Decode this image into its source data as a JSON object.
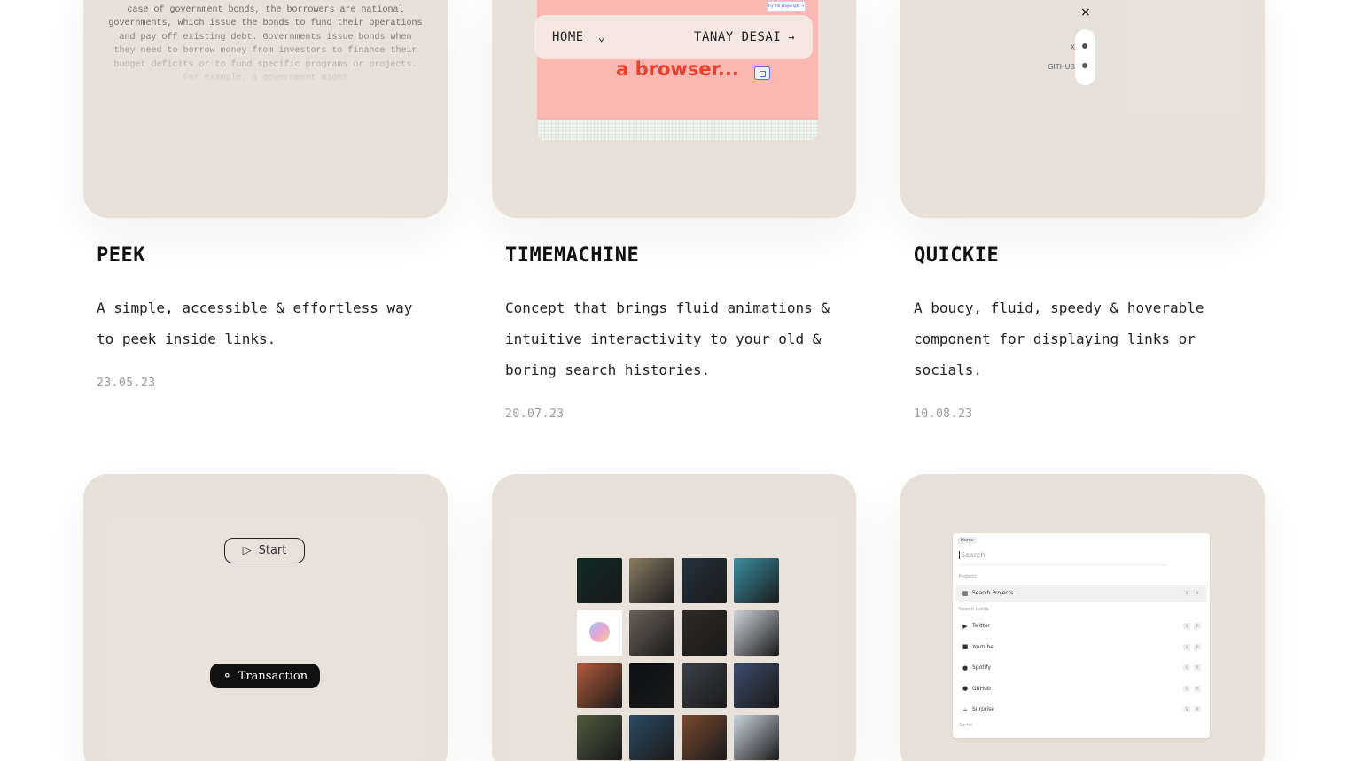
{
  "projects": [
    {
      "title": "PEEK",
      "description": "A simple, accessible & effortless way to peek inside links.",
      "date": "23.05.23",
      "preview_text": "stream of income through regular interest payments. In the case of government bonds, the borrowers are national governments, which issue the bonds to fund their operations and pay off existing debt. Governments issue bonds when they need to borrow money from investors to finance their budget deficits or to fund specific programs or projects. For example, a government might"
    },
    {
      "title": "TIMEMACHINE",
      "description": "Concept that brings fluid animations & intuitive interactivity to your old & boring search histories.",
      "date": "20.07.23",
      "nav_home": "HOME",
      "nav_name": "TANAY DESAI",
      "browser_text": "a browser...",
      "small_button": "Try the playwright →"
    },
    {
      "title": "QUICKIE",
      "description": "A boucy, fluid, speedy & hoverable component for displaying links or socials.",
      "date": "10.08.23",
      "close": "×",
      "label_x": "X",
      "label_github": "GITHUB"
    }
  ],
  "bottom_left": {
    "start_label": "Start",
    "transaction_label": "Transaction"
  },
  "image_grid": {
    "colors": [
      [
        "#0f2a26",
        "#8b7b63",
        "#243340",
        "#3b8ea1"
      ],
      [
        "#ffffff",
        "#6a6155",
        "#2e2a25",
        "#cfd3d9"
      ],
      [
        "#b35a3b",
        "#0d1014",
        "#3d4148",
        "#3b4c6b"
      ],
      [
        "#4f5a3c",
        "#2a4a63",
        "#7a4a2e",
        "#c9d6e0"
      ]
    ]
  },
  "search_panel": {
    "home": "Home",
    "search_placeholder": "Search",
    "section_projects": "Projects",
    "search_projects": "Search Projects...",
    "section_search_inside": "Search inside",
    "items": [
      {
        "label": "Twitter",
        "icon": "twitter-icon",
        "glyph": "▶"
      },
      {
        "label": "Youtube",
        "icon": "youtube-icon",
        "glyph": "■"
      },
      {
        "label": "Spotify",
        "icon": "spotify-icon",
        "glyph": "●"
      },
      {
        "label": "GitHub",
        "icon": "github-icon",
        "glyph": "●"
      },
      {
        "label": "Surprise",
        "icon": "surprise-icon",
        "glyph": "☕"
      }
    ],
    "section_social": "Social",
    "kbd_1": "S",
    "kbd_2": "P"
  }
}
